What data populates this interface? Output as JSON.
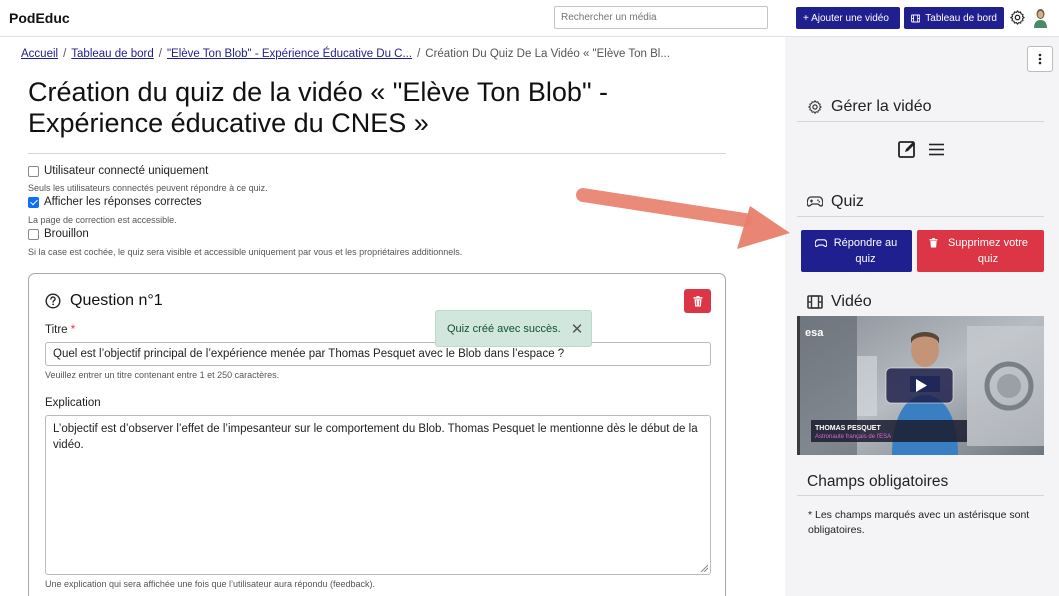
{
  "header": {
    "brand": "PodEduc",
    "search_placeholder": "Rechercher un média",
    "add_video_label": "+ Ajouter une vidéo",
    "dashboard_label": "Tableau de bord"
  },
  "breadcrumb": {
    "items": [
      "Accueil",
      "Tableau de bord",
      "\"Elève Ton Blob\" - Expérience Éducative Du C..."
    ],
    "current": "Création Du Quiz De La Vidéo « \"Elève Ton Bl..."
  },
  "page": {
    "title": "Création du quiz de la vidéo « \"Elève Ton Blob\" - Expérience éducative du CNES »"
  },
  "options": [
    {
      "label": "Utilisateur connecté uniquement",
      "checked": false,
      "help": "Seuls les utilisateurs connectés peuvent répondre à ce quiz."
    },
    {
      "label": "Afficher les réponses correctes",
      "checked": true,
      "help": "La page de correction est accessible."
    },
    {
      "label": "Brouillon",
      "checked": false,
      "help": "Si la case est cochée, le quiz sera visible et accessible uniquement par vous et les propriétaires additionnels."
    }
  ],
  "question": {
    "heading": "Question n°1",
    "title_label": "Titre",
    "required_mark": "*",
    "title_value": "Quel est l’objectif principal de l’expérience menée par Thomas Pesquet avec le Blob dans l’espace ?",
    "title_help": "Veuillez entrer un titre contenant entre 1 et 250 caractères.",
    "explanation_label": "Explication",
    "explanation_value": "L’objectif est d’observer l’effet de l’impesanteur sur le comportement du Blob. Thomas Pesquet le mentionne dès le début de la vidéo.",
    "explanation_help": "Une explication qui sera affichée une fois que l’utilisateur aura répondu (feedback)."
  },
  "toast": {
    "message": "Quiz créé avec succès.",
    "close": "✕"
  },
  "sidebar": {
    "manage_title": "Gérer la vidéo",
    "quiz_title": "Quiz",
    "answer_button": "Répondre au quiz",
    "delete_button": "Supprimez votre quiz",
    "video_title": "Vidéo",
    "video_caption_name": "THOMAS PESQUET",
    "video_caption_sub": "Astronaute français de l'ESA",
    "video_logo": "esa",
    "required_title": "Champs obligatoires",
    "required_note": "* Les champs marqués avec un astérisque sont obligatoires."
  },
  "colors": {
    "primary": "#1f1f8f",
    "danger": "#dc3545",
    "success_bg": "#d1e7dd",
    "arrow": "#e8806c"
  }
}
